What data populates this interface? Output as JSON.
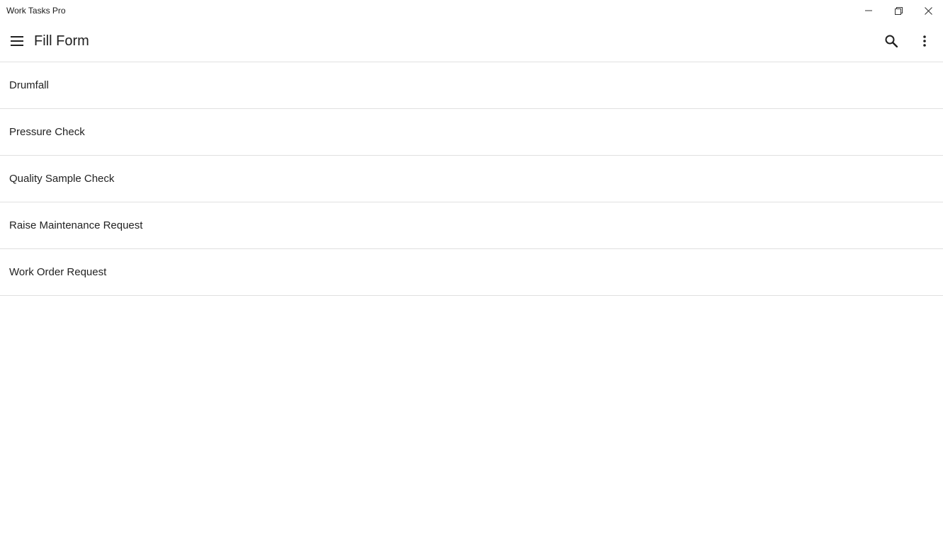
{
  "window": {
    "title": "Work Tasks Pro",
    "controls": {
      "minimize_icon": "minimize-icon",
      "maximize_icon": "restore-icon",
      "close_icon": "close-icon"
    }
  },
  "appbar": {
    "menu_icon": "hamburger-menu-icon",
    "title": "Fill Form",
    "search_icon": "search-icon",
    "more_icon": "more-vertical-icon"
  },
  "forms": {
    "items": [
      {
        "label": "Drumfall"
      },
      {
        "label": "Pressure Check"
      },
      {
        "label": "Quality Sample Check"
      },
      {
        "label": "Raise Maintenance Request"
      },
      {
        "label": "Work Order Request"
      }
    ]
  },
  "colors": {
    "background": "#ffffff",
    "divider": "#e0e0e0",
    "text": "#202020"
  }
}
